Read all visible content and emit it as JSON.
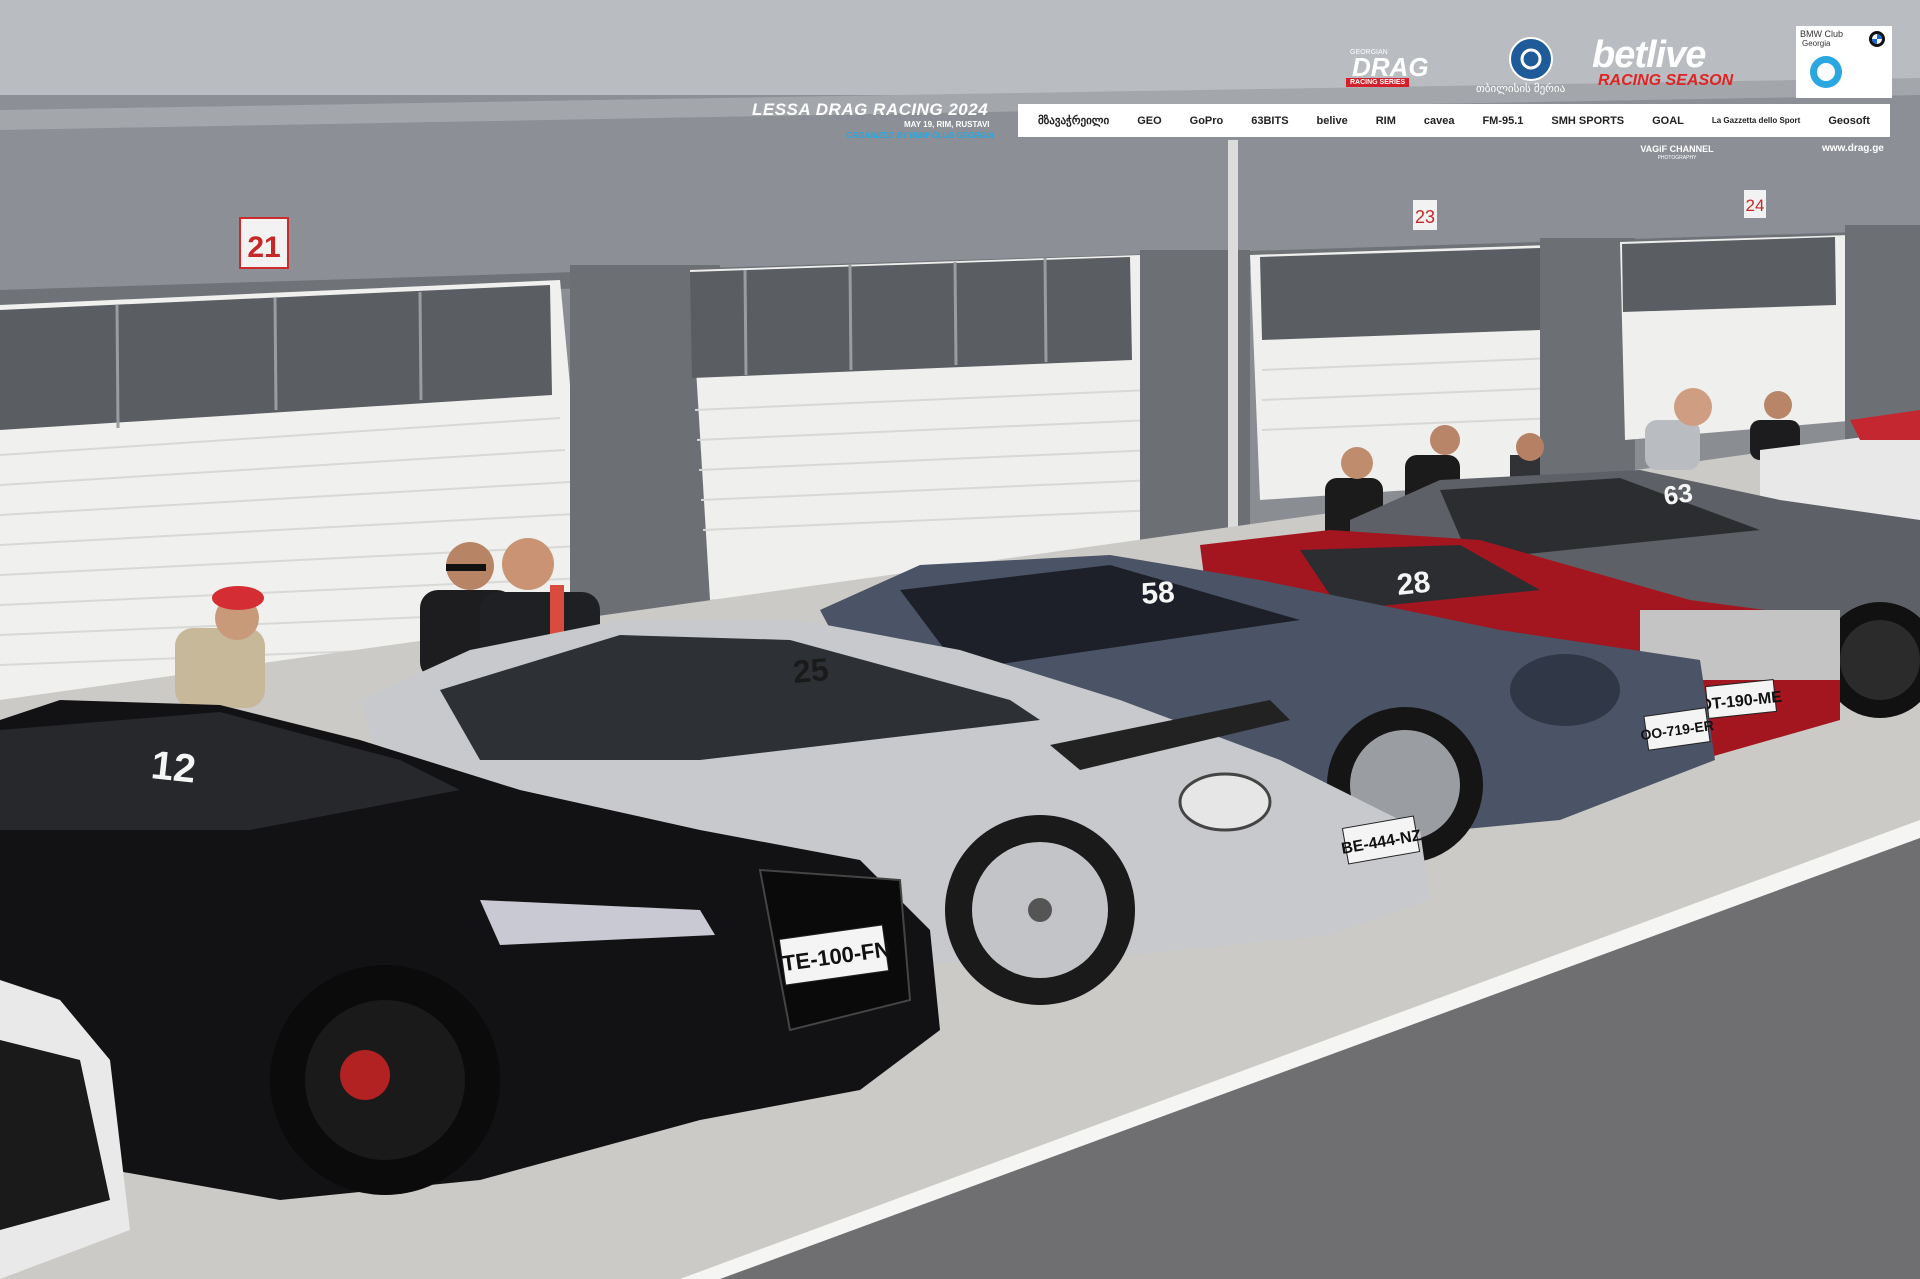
{
  "overlay": {
    "event_title": "LESSA DRAG RACING 2024",
    "event_date_place": "MAY 19, RIM, RUSTAVI",
    "organizer": "ORGANIZED BY BMW CLUB GEORGIA",
    "photographer": "VAGiF CHANNEL",
    "photographer_sub": "PHOTOGRAPHY",
    "website": "www.drag.ge",
    "drag_brand": "DRAG",
    "drag_top": "GEORGIAN",
    "drag_sub": "RACING SERIES",
    "tbilisi_city": "თბილისის მერია",
    "belive_main": "betlive",
    "belive_sub": "RACING SEASON",
    "bmw_club_1": "BMW Club",
    "bmw_club_2": "Georgia",
    "sponsors": [
      "მზავაჭრეილი",
      "GEO",
      "GoPro",
      "63BITS",
      "belive",
      "RIM",
      "cavea",
      "FM-95.1",
      "SMH SPORTS",
      "GOAL",
      "La Gazzetta dello Sport",
      "Geosoft"
    ]
  },
  "scene": {
    "garage_numbers": [
      "21",
      "23",
      "24"
    ],
    "race_numbers": [
      "12",
      "25",
      "58",
      "28",
      "63"
    ],
    "plates": [
      "TE-100-FN",
      "BE-444-NZ",
      "OO-719-ER",
      "DT-190-ME"
    ]
  },
  "colors": {
    "building": "#8f9399",
    "garage_door": "#f1f1ef",
    "asphalt": "#7d7d80",
    "accent_red": "#d51f2a",
    "accent_blue": "#2aa7e0"
  }
}
